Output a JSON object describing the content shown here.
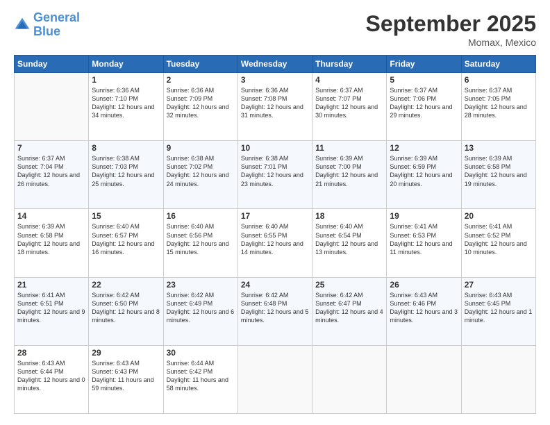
{
  "header": {
    "logo_line1": "General",
    "logo_line2": "Blue",
    "month": "September 2025",
    "location": "Momax, Mexico"
  },
  "weekdays": [
    "Sunday",
    "Monday",
    "Tuesday",
    "Wednesday",
    "Thursday",
    "Friday",
    "Saturday"
  ],
  "weeks": [
    [
      {
        "day": "",
        "sunrise": "",
        "sunset": "",
        "daylight": ""
      },
      {
        "day": "1",
        "sunrise": "Sunrise: 6:36 AM",
        "sunset": "Sunset: 7:10 PM",
        "daylight": "Daylight: 12 hours and 34 minutes."
      },
      {
        "day": "2",
        "sunrise": "Sunrise: 6:36 AM",
        "sunset": "Sunset: 7:09 PM",
        "daylight": "Daylight: 12 hours and 32 minutes."
      },
      {
        "day": "3",
        "sunrise": "Sunrise: 6:36 AM",
        "sunset": "Sunset: 7:08 PM",
        "daylight": "Daylight: 12 hours and 31 minutes."
      },
      {
        "day": "4",
        "sunrise": "Sunrise: 6:37 AM",
        "sunset": "Sunset: 7:07 PM",
        "daylight": "Daylight: 12 hours and 30 minutes."
      },
      {
        "day": "5",
        "sunrise": "Sunrise: 6:37 AM",
        "sunset": "Sunset: 7:06 PM",
        "daylight": "Daylight: 12 hours and 29 minutes."
      },
      {
        "day": "6",
        "sunrise": "Sunrise: 6:37 AM",
        "sunset": "Sunset: 7:05 PM",
        "daylight": "Daylight: 12 hours and 28 minutes."
      }
    ],
    [
      {
        "day": "7",
        "sunrise": "Sunrise: 6:37 AM",
        "sunset": "Sunset: 7:04 PM",
        "daylight": "Daylight: 12 hours and 26 minutes."
      },
      {
        "day": "8",
        "sunrise": "Sunrise: 6:38 AM",
        "sunset": "Sunset: 7:03 PM",
        "daylight": "Daylight: 12 hours and 25 minutes."
      },
      {
        "day": "9",
        "sunrise": "Sunrise: 6:38 AM",
        "sunset": "Sunset: 7:02 PM",
        "daylight": "Daylight: 12 hours and 24 minutes."
      },
      {
        "day": "10",
        "sunrise": "Sunrise: 6:38 AM",
        "sunset": "Sunset: 7:01 PM",
        "daylight": "Daylight: 12 hours and 23 minutes."
      },
      {
        "day": "11",
        "sunrise": "Sunrise: 6:39 AM",
        "sunset": "Sunset: 7:00 PM",
        "daylight": "Daylight: 12 hours and 21 minutes."
      },
      {
        "day": "12",
        "sunrise": "Sunrise: 6:39 AM",
        "sunset": "Sunset: 6:59 PM",
        "daylight": "Daylight: 12 hours and 20 minutes."
      },
      {
        "day": "13",
        "sunrise": "Sunrise: 6:39 AM",
        "sunset": "Sunset: 6:58 PM",
        "daylight": "Daylight: 12 hours and 19 minutes."
      }
    ],
    [
      {
        "day": "14",
        "sunrise": "Sunrise: 6:39 AM",
        "sunset": "Sunset: 6:58 PM",
        "daylight": "Daylight: 12 hours and 18 minutes."
      },
      {
        "day": "15",
        "sunrise": "Sunrise: 6:40 AM",
        "sunset": "Sunset: 6:57 PM",
        "daylight": "Daylight: 12 hours and 16 minutes."
      },
      {
        "day": "16",
        "sunrise": "Sunrise: 6:40 AM",
        "sunset": "Sunset: 6:56 PM",
        "daylight": "Daylight: 12 hours and 15 minutes."
      },
      {
        "day": "17",
        "sunrise": "Sunrise: 6:40 AM",
        "sunset": "Sunset: 6:55 PM",
        "daylight": "Daylight: 12 hours and 14 minutes."
      },
      {
        "day": "18",
        "sunrise": "Sunrise: 6:40 AM",
        "sunset": "Sunset: 6:54 PM",
        "daylight": "Daylight: 12 hours and 13 minutes."
      },
      {
        "day": "19",
        "sunrise": "Sunrise: 6:41 AM",
        "sunset": "Sunset: 6:53 PM",
        "daylight": "Daylight: 12 hours and 11 minutes."
      },
      {
        "day": "20",
        "sunrise": "Sunrise: 6:41 AM",
        "sunset": "Sunset: 6:52 PM",
        "daylight": "Daylight: 12 hours and 10 minutes."
      }
    ],
    [
      {
        "day": "21",
        "sunrise": "Sunrise: 6:41 AM",
        "sunset": "Sunset: 6:51 PM",
        "daylight": "Daylight: 12 hours and 9 minutes."
      },
      {
        "day": "22",
        "sunrise": "Sunrise: 6:42 AM",
        "sunset": "Sunset: 6:50 PM",
        "daylight": "Daylight: 12 hours and 8 minutes."
      },
      {
        "day": "23",
        "sunrise": "Sunrise: 6:42 AM",
        "sunset": "Sunset: 6:49 PM",
        "daylight": "Daylight: 12 hours and 6 minutes."
      },
      {
        "day": "24",
        "sunrise": "Sunrise: 6:42 AM",
        "sunset": "Sunset: 6:48 PM",
        "daylight": "Daylight: 12 hours and 5 minutes."
      },
      {
        "day": "25",
        "sunrise": "Sunrise: 6:42 AM",
        "sunset": "Sunset: 6:47 PM",
        "daylight": "Daylight: 12 hours and 4 minutes."
      },
      {
        "day": "26",
        "sunrise": "Sunrise: 6:43 AM",
        "sunset": "Sunset: 6:46 PM",
        "daylight": "Daylight: 12 hours and 3 minutes."
      },
      {
        "day": "27",
        "sunrise": "Sunrise: 6:43 AM",
        "sunset": "Sunset: 6:45 PM",
        "daylight": "Daylight: 12 hours and 1 minute."
      }
    ],
    [
      {
        "day": "28",
        "sunrise": "Sunrise: 6:43 AM",
        "sunset": "Sunset: 6:44 PM",
        "daylight": "Daylight: 12 hours and 0 minutes."
      },
      {
        "day": "29",
        "sunrise": "Sunrise: 6:43 AM",
        "sunset": "Sunset: 6:43 PM",
        "daylight": "Daylight: 11 hours and 59 minutes."
      },
      {
        "day": "30",
        "sunrise": "Sunrise: 6:44 AM",
        "sunset": "Sunset: 6:42 PM",
        "daylight": "Daylight: 11 hours and 58 minutes."
      },
      {
        "day": "",
        "sunrise": "",
        "sunset": "",
        "daylight": ""
      },
      {
        "day": "",
        "sunrise": "",
        "sunset": "",
        "daylight": ""
      },
      {
        "day": "",
        "sunrise": "",
        "sunset": "",
        "daylight": ""
      },
      {
        "day": "",
        "sunrise": "",
        "sunset": "",
        "daylight": ""
      }
    ]
  ]
}
